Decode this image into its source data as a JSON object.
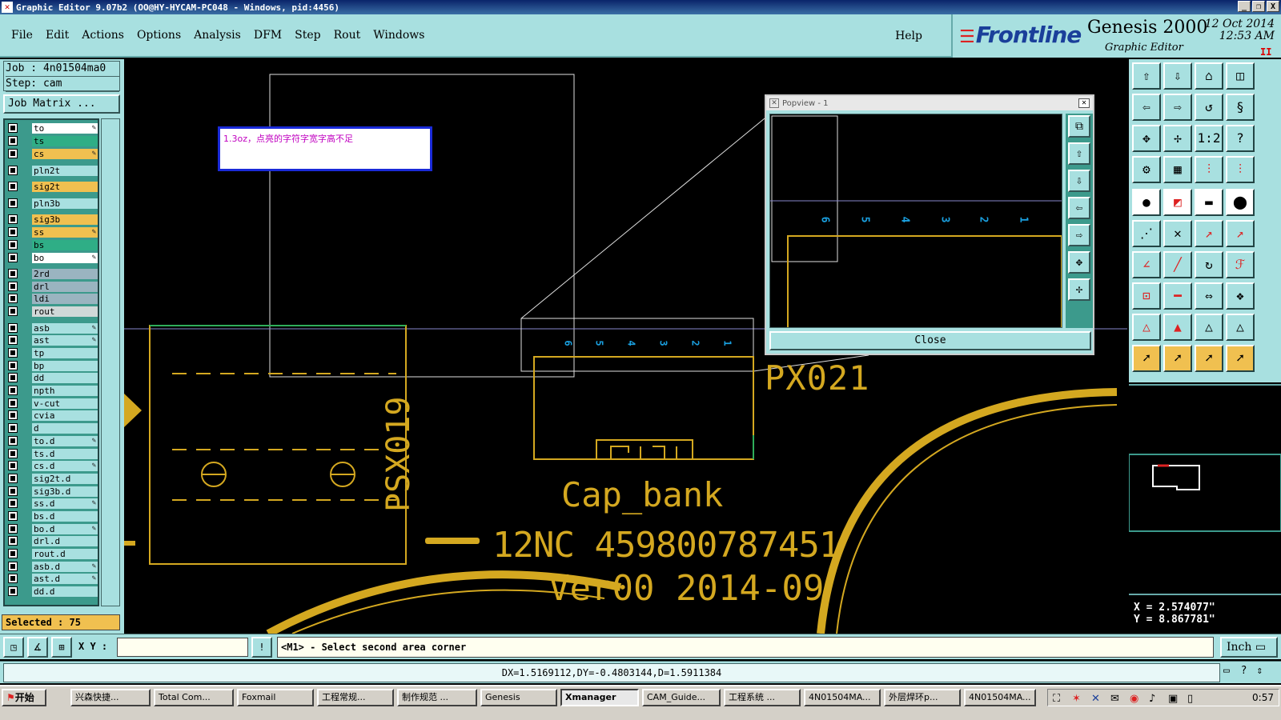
{
  "window": {
    "title": "Graphic Editor 9.07b2  (OO@HY-HYCAM-PC048 - Windows, pid:4456)",
    "controls": [
      "_",
      "❐",
      "X"
    ]
  },
  "menu": {
    "items": [
      "File",
      "Edit",
      "Actions",
      "Options",
      "Analysis",
      "DFM",
      "Step",
      "Rout",
      "Windows"
    ],
    "help": "Help"
  },
  "brand": {
    "logo": "Frontline",
    "product": "Genesis 2000",
    "subtitle": "Graphic Editor",
    "date": "12 Oct 2014",
    "time": "12:53 AM",
    "rec_mark": "II"
  },
  "job": {
    "job_line": "Job : 4n01504ma0",
    "step_line": "Step: cam",
    "matrix_button": "Job Matrix ...",
    "selected": "Selected : 75"
  },
  "layers": [
    {
      "name": "to",
      "color": "wh",
      "pen": "✎"
    },
    {
      "name": "ts",
      "color": "gr",
      "pen": ""
    },
    {
      "name": "cs",
      "color": "sig",
      "pen": "✎"
    },
    {
      "name": "pln2t",
      "color": "pl",
      "pen": ""
    },
    {
      "name": "sig2t",
      "color": "sig",
      "pen": ""
    },
    {
      "name": "pln3b",
      "color": "pl",
      "pen": ""
    },
    {
      "name": "sig3b",
      "color": "sig",
      "pen": ""
    },
    {
      "name": "ss",
      "color": "sig",
      "pen": "✎"
    },
    {
      "name": "bs",
      "color": "gr",
      "pen": ""
    },
    {
      "name": "bo",
      "color": "wh",
      "pen": "✎"
    },
    {
      "name": "2rd",
      "color": "gy",
      "pen": ""
    },
    {
      "name": "drl",
      "color": "gy",
      "pen": ""
    },
    {
      "name": "ldi",
      "color": "gy",
      "pen": ""
    },
    {
      "name": "rout",
      "color": "lg",
      "pen": ""
    },
    {
      "name": "asb",
      "color": "cy",
      "pen": "✎"
    },
    {
      "name": "ast",
      "color": "cy",
      "pen": "✎"
    },
    {
      "name": "tp",
      "color": "cy",
      "pen": ""
    },
    {
      "name": "bp",
      "color": "cy",
      "pen": ""
    },
    {
      "name": "dd",
      "color": "cy",
      "pen": ""
    },
    {
      "name": "npth",
      "color": "cy",
      "pen": ""
    },
    {
      "name": "v-cut",
      "color": "cy",
      "pen": ""
    },
    {
      "name": "cvia",
      "color": "cy",
      "pen": ""
    },
    {
      "name": "d",
      "color": "cy",
      "pen": ""
    },
    {
      "name": "to.d",
      "color": "cy",
      "pen": "✎"
    },
    {
      "name": "ts.d",
      "color": "cy",
      "pen": ""
    },
    {
      "name": "cs.d",
      "color": "cy",
      "pen": "✎"
    },
    {
      "name": "sig2t.d",
      "color": "cy",
      "pen": ""
    },
    {
      "name": "sig3b.d",
      "color": "cy",
      "pen": ""
    },
    {
      "name": "ss.d",
      "color": "cy",
      "pen": "✎"
    },
    {
      "name": "bs.d",
      "color": "cy",
      "pen": ""
    },
    {
      "name": "bo.d",
      "color": "cy",
      "pen": "✎"
    },
    {
      "name": "drl.d",
      "color": "cy",
      "pen": ""
    },
    {
      "name": "rout.d",
      "color": "cy",
      "pen": ""
    },
    {
      "name": "asb.d",
      "color": "cy",
      "pen": "✎"
    },
    {
      "name": "ast.d",
      "color": "cy",
      "pen": "✎"
    },
    {
      "name": "dd.d",
      "color": "cy",
      "pen": ""
    }
  ],
  "canvas": {
    "note": "1.3oz，点亮的字符字宽字高不足",
    "labels": {
      "ref_px": "PX021",
      "ref_psx": "PSX019",
      "cap": "Cap_bank",
      "part": "12NC 459800787451",
      "ver": "Ver00 2014-09"
    },
    "pin_digits": [
      "6",
      "5",
      "4",
      "3",
      "2",
      "1"
    ]
  },
  "popview": {
    "title": "Popview - 1",
    "close_label": "Close",
    "pin_digits": [
      "6",
      "5",
      "4",
      "3",
      "2",
      "1"
    ]
  },
  "coords": {
    "x": "X = 2.574077\"",
    "y": "Y = 8.867781\""
  },
  "command": {
    "xy_label": "X Y :",
    "xy_value": "",
    "prompt": "<M1> - Select second area corner",
    "unit": "Inch ▭",
    "status": "DX=1.5169112,DY=-0.4803144,D=1.5911384"
  },
  "taskbar": {
    "start": "开始",
    "tasks": [
      "兴森快捷...",
      "Total Com...",
      "Foxmail",
      "工程常规...",
      "制作规范 ...",
      "Genesis",
      "Xmanager",
      "CAM_Guide...",
      "工程系统 ...",
      "4N01504MA...",
      "外层焊环p...",
      "4N01504MA..."
    ],
    "active_task": 6,
    "clock": "0:57"
  },
  "colors": {
    "panel": "#a8e0e0",
    "layer_bg": "#3c9a8c",
    "signal_layer": "#f0c050",
    "silkscreen": "#d4a820",
    "canvas_bg": "#000000",
    "pin_text": "#1aa0e0",
    "note_text": "#c000c0"
  }
}
